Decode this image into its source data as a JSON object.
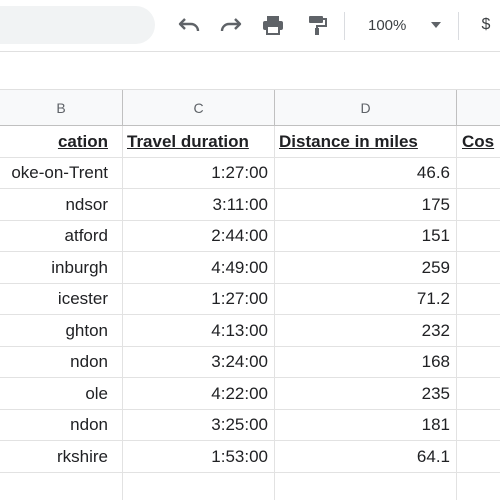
{
  "toolbar": {
    "zoom": "100%",
    "currency_symbol": "$",
    "icons": [
      "undo-icon",
      "redo-icon",
      "print-icon",
      "paint-format-icon"
    ]
  },
  "columns": [
    "B",
    "C",
    "D"
  ],
  "header_row": {
    "location": "cation",
    "duration": "Travel duration",
    "distance": "Distance in miles",
    "cost": "Cos"
  },
  "rows": [
    {
      "location": "oke-on-Trent",
      "duration": "1:27:00",
      "distance": "46.6"
    },
    {
      "location": "ndsor",
      "duration": "3:11:00",
      "distance": "175"
    },
    {
      "location": "atford",
      "duration": "2:44:00",
      "distance": "151"
    },
    {
      "location": "inburgh",
      "duration": "4:49:00",
      "distance": "259"
    },
    {
      "location": "icester",
      "duration": "1:27:00",
      "distance": "71.2"
    },
    {
      "location": "ghton",
      "duration": "4:13:00",
      "distance": "232"
    },
    {
      "location": "ndon",
      "duration": "3:24:00",
      "distance": "168"
    },
    {
      "location": "ole",
      "duration": "4:22:00",
      "distance": "235"
    },
    {
      "location": "ndon",
      "duration": "3:25:00",
      "distance": "181"
    },
    {
      "location": "rkshire",
      "duration": "1:53:00",
      "distance": "64.1"
    },
    {
      "location": "",
      "duration": "",
      "distance": ""
    }
  ]
}
